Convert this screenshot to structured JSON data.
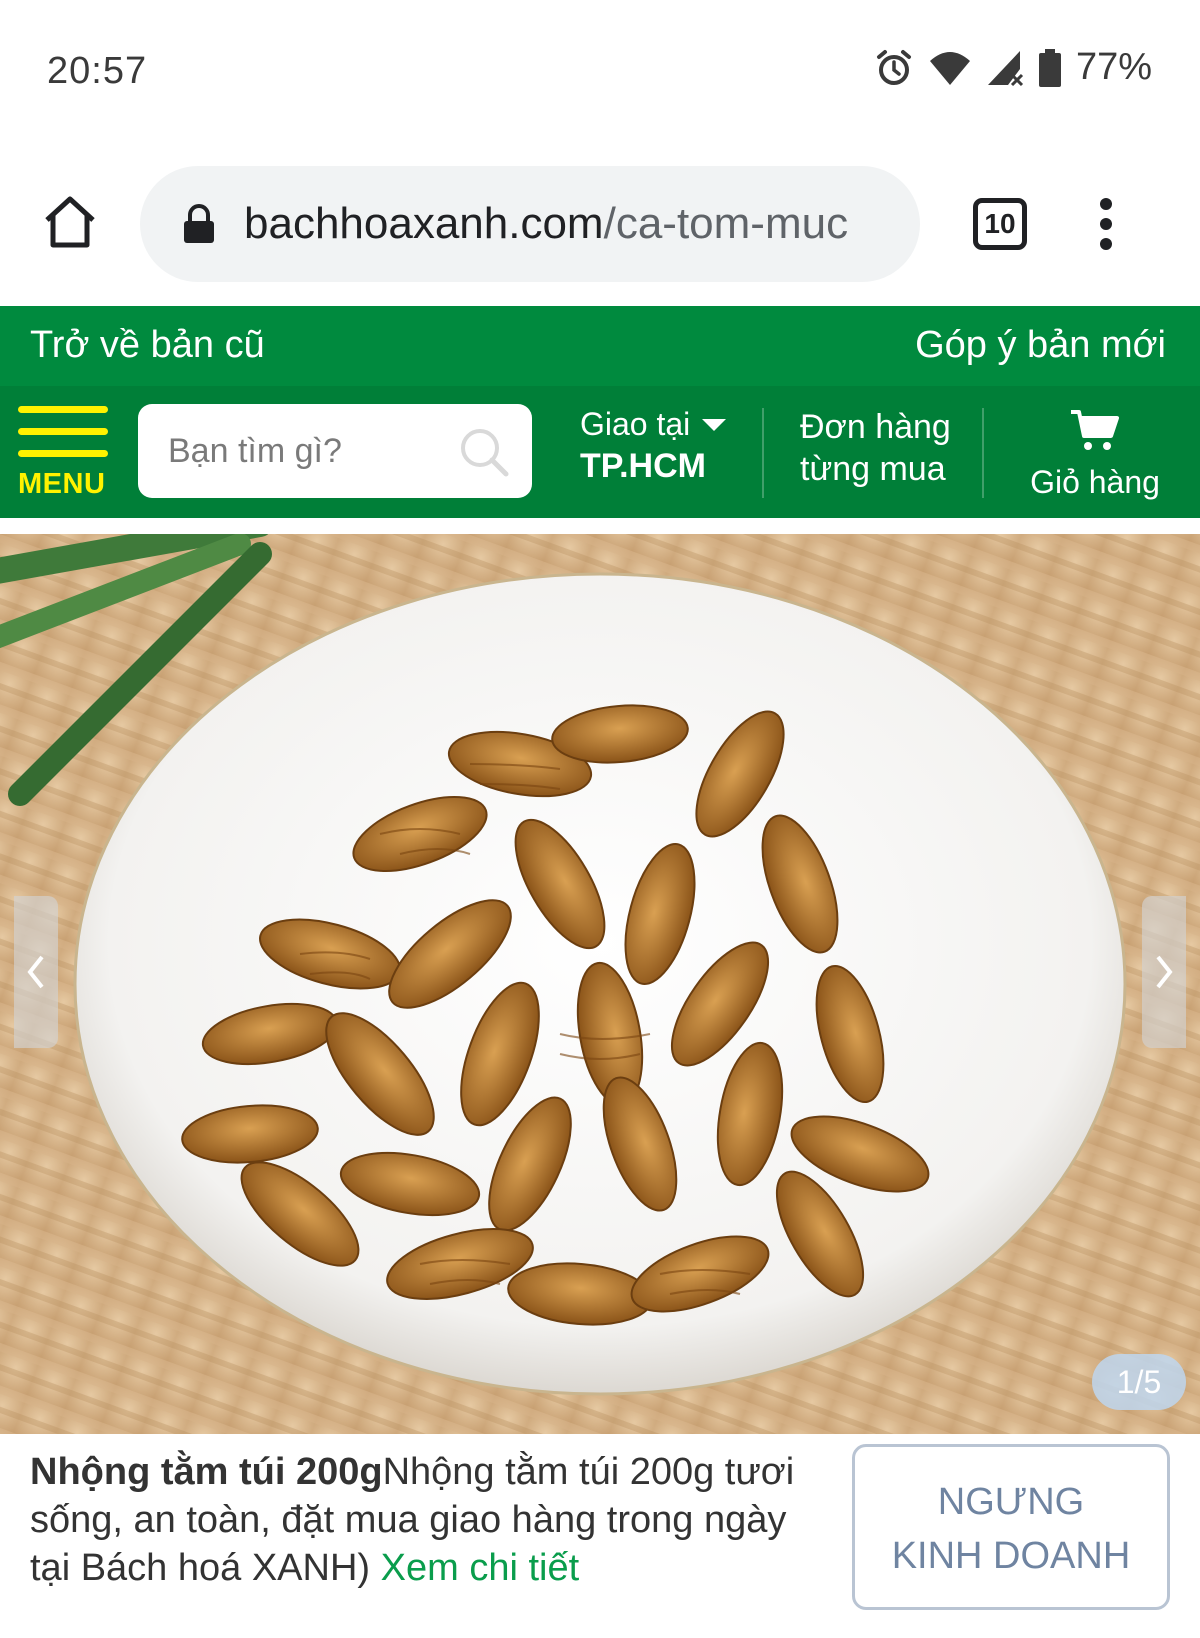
{
  "status_bar": {
    "time": "20:57",
    "battery": "77%",
    "icons": [
      "alarm-icon",
      "wifi-icon",
      "signal-icon",
      "battery-icon"
    ]
  },
  "browser": {
    "url_host": "bachhoaxanh.com",
    "url_path": "/ca-tom-muc",
    "tab_count": "10",
    "icons": [
      "home-icon",
      "lock-icon",
      "more-vert-icon"
    ]
  },
  "banner": {
    "left_label": "Trở về bản cũ",
    "right_label": "Góp ý bản mới"
  },
  "nav": {
    "menu_label": "MENU",
    "search_placeholder": "Bạn tìm gì?",
    "deliver_label": "Giao tại",
    "deliver_city": "TP.HCM",
    "orders_line1": "Đơn hàng",
    "orders_line2": "từng mua",
    "cart_label": "Giỏ hàng"
  },
  "gallery": {
    "counter": "1/5"
  },
  "product": {
    "name": "Nhộng tằm túi 200g",
    "description": "Nhộng tằm túi 200g tươi sống, an toàn, đặt mua giao hàng trong ngày tại Bách hoá XANH)",
    "link_label": "Xem chi tiết",
    "stop_line1": "NGƯNG",
    "stop_line2": "KINH DOANH"
  },
  "colors": {
    "brand_green": "#008a3e",
    "nav_green": "#007f38",
    "menu_yellow": "#fff200",
    "link_green": "#0a9d4c",
    "disabled_blue": "#6f84a1"
  }
}
